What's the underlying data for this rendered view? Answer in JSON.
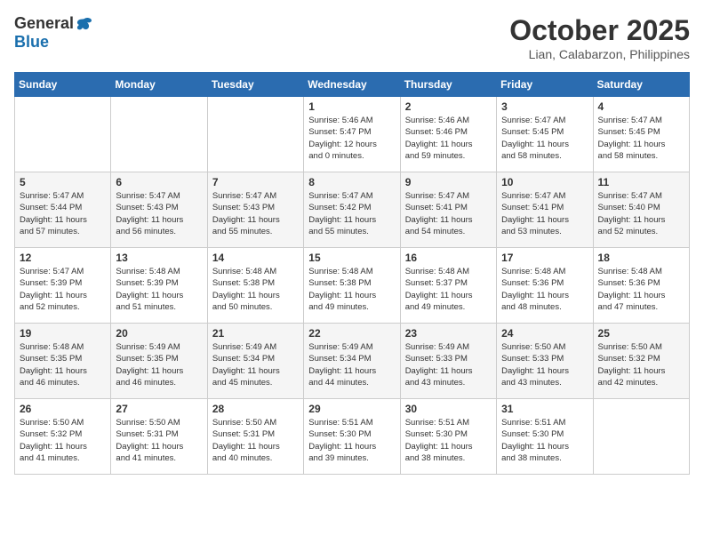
{
  "header": {
    "logo_general": "General",
    "logo_blue": "Blue",
    "month_title": "October 2025",
    "location": "Lian, Calabarzon, Philippines"
  },
  "days_of_week": [
    "Sunday",
    "Monday",
    "Tuesday",
    "Wednesday",
    "Thursday",
    "Friday",
    "Saturday"
  ],
  "weeks": [
    [
      {
        "day": "",
        "info": ""
      },
      {
        "day": "",
        "info": ""
      },
      {
        "day": "",
        "info": ""
      },
      {
        "day": "1",
        "info": "Sunrise: 5:46 AM\nSunset: 5:47 PM\nDaylight: 12 hours\nand 0 minutes."
      },
      {
        "day": "2",
        "info": "Sunrise: 5:46 AM\nSunset: 5:46 PM\nDaylight: 11 hours\nand 59 minutes."
      },
      {
        "day": "3",
        "info": "Sunrise: 5:47 AM\nSunset: 5:45 PM\nDaylight: 11 hours\nand 58 minutes."
      },
      {
        "day": "4",
        "info": "Sunrise: 5:47 AM\nSunset: 5:45 PM\nDaylight: 11 hours\nand 58 minutes."
      }
    ],
    [
      {
        "day": "5",
        "info": "Sunrise: 5:47 AM\nSunset: 5:44 PM\nDaylight: 11 hours\nand 57 minutes."
      },
      {
        "day": "6",
        "info": "Sunrise: 5:47 AM\nSunset: 5:43 PM\nDaylight: 11 hours\nand 56 minutes."
      },
      {
        "day": "7",
        "info": "Sunrise: 5:47 AM\nSunset: 5:43 PM\nDaylight: 11 hours\nand 55 minutes."
      },
      {
        "day": "8",
        "info": "Sunrise: 5:47 AM\nSunset: 5:42 PM\nDaylight: 11 hours\nand 55 minutes."
      },
      {
        "day": "9",
        "info": "Sunrise: 5:47 AM\nSunset: 5:41 PM\nDaylight: 11 hours\nand 54 minutes."
      },
      {
        "day": "10",
        "info": "Sunrise: 5:47 AM\nSunset: 5:41 PM\nDaylight: 11 hours\nand 53 minutes."
      },
      {
        "day": "11",
        "info": "Sunrise: 5:47 AM\nSunset: 5:40 PM\nDaylight: 11 hours\nand 52 minutes."
      }
    ],
    [
      {
        "day": "12",
        "info": "Sunrise: 5:47 AM\nSunset: 5:39 PM\nDaylight: 11 hours\nand 52 minutes."
      },
      {
        "day": "13",
        "info": "Sunrise: 5:48 AM\nSunset: 5:39 PM\nDaylight: 11 hours\nand 51 minutes."
      },
      {
        "day": "14",
        "info": "Sunrise: 5:48 AM\nSunset: 5:38 PM\nDaylight: 11 hours\nand 50 minutes."
      },
      {
        "day": "15",
        "info": "Sunrise: 5:48 AM\nSunset: 5:38 PM\nDaylight: 11 hours\nand 49 minutes."
      },
      {
        "day": "16",
        "info": "Sunrise: 5:48 AM\nSunset: 5:37 PM\nDaylight: 11 hours\nand 49 minutes."
      },
      {
        "day": "17",
        "info": "Sunrise: 5:48 AM\nSunset: 5:36 PM\nDaylight: 11 hours\nand 48 minutes."
      },
      {
        "day": "18",
        "info": "Sunrise: 5:48 AM\nSunset: 5:36 PM\nDaylight: 11 hours\nand 47 minutes."
      }
    ],
    [
      {
        "day": "19",
        "info": "Sunrise: 5:48 AM\nSunset: 5:35 PM\nDaylight: 11 hours\nand 46 minutes."
      },
      {
        "day": "20",
        "info": "Sunrise: 5:49 AM\nSunset: 5:35 PM\nDaylight: 11 hours\nand 46 minutes."
      },
      {
        "day": "21",
        "info": "Sunrise: 5:49 AM\nSunset: 5:34 PM\nDaylight: 11 hours\nand 45 minutes."
      },
      {
        "day": "22",
        "info": "Sunrise: 5:49 AM\nSunset: 5:34 PM\nDaylight: 11 hours\nand 44 minutes."
      },
      {
        "day": "23",
        "info": "Sunrise: 5:49 AM\nSunset: 5:33 PM\nDaylight: 11 hours\nand 43 minutes."
      },
      {
        "day": "24",
        "info": "Sunrise: 5:50 AM\nSunset: 5:33 PM\nDaylight: 11 hours\nand 43 minutes."
      },
      {
        "day": "25",
        "info": "Sunrise: 5:50 AM\nSunset: 5:32 PM\nDaylight: 11 hours\nand 42 minutes."
      }
    ],
    [
      {
        "day": "26",
        "info": "Sunrise: 5:50 AM\nSunset: 5:32 PM\nDaylight: 11 hours\nand 41 minutes."
      },
      {
        "day": "27",
        "info": "Sunrise: 5:50 AM\nSunset: 5:31 PM\nDaylight: 11 hours\nand 41 minutes."
      },
      {
        "day": "28",
        "info": "Sunrise: 5:50 AM\nSunset: 5:31 PM\nDaylight: 11 hours\nand 40 minutes."
      },
      {
        "day": "29",
        "info": "Sunrise: 5:51 AM\nSunset: 5:30 PM\nDaylight: 11 hours\nand 39 minutes."
      },
      {
        "day": "30",
        "info": "Sunrise: 5:51 AM\nSunset: 5:30 PM\nDaylight: 11 hours\nand 38 minutes."
      },
      {
        "day": "31",
        "info": "Sunrise: 5:51 AM\nSunset: 5:30 PM\nDaylight: 11 hours\nand 38 minutes."
      },
      {
        "day": "",
        "info": ""
      }
    ]
  ]
}
